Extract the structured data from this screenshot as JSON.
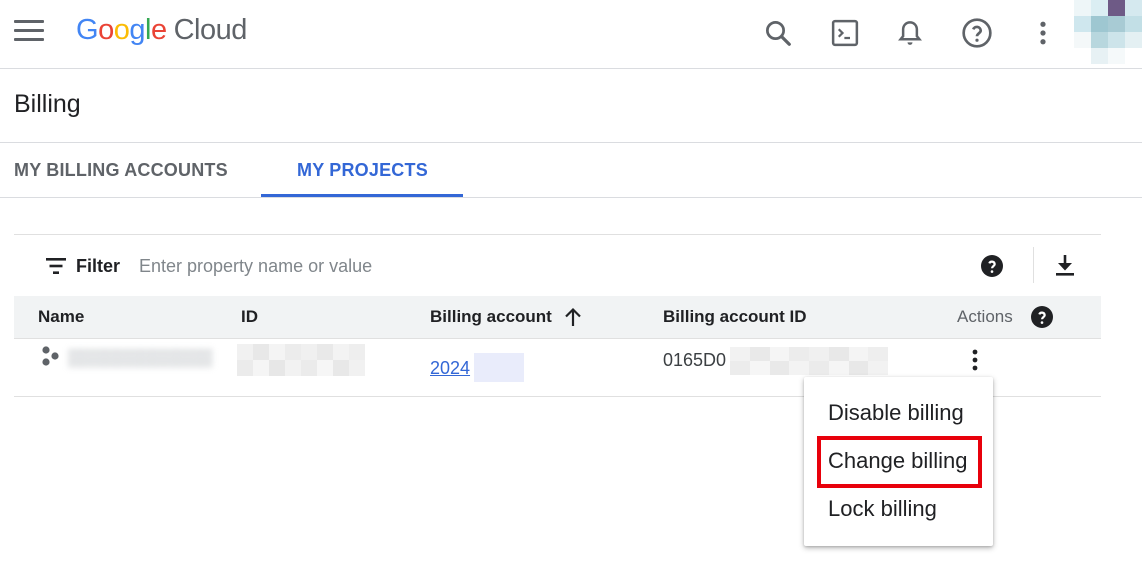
{
  "header": {
    "brand_letters": [
      "G",
      "o",
      "o",
      "g",
      "l",
      "e"
    ],
    "brand_product": "Cloud",
    "icons": [
      "menu-icon",
      "search-icon",
      "cloud-shell-icon",
      "notifications-icon",
      "help-icon",
      "more-vert-icon"
    ]
  },
  "page": {
    "title": "Billing"
  },
  "tabs": [
    {
      "label": "MY BILLING ACCOUNTS",
      "active": false
    },
    {
      "label": "MY PROJECTS",
      "active": true
    }
  ],
  "filter": {
    "label": "Filter",
    "placeholder": "Enter property name or value"
  },
  "table": {
    "columns": [
      "Name",
      "ID",
      "Billing account",
      "Billing account ID",
      "Actions"
    ],
    "sort_column": "Billing account",
    "sort_direction": "ascending",
    "rows": [
      {
        "name": "hidden",
        "billing_account": "2024",
        "billing_account_id": "0165D0"
      }
    ]
  },
  "actions_menu": {
    "items": [
      "Disable billing",
      "Change billing",
      "Lock billing"
    ],
    "highlighted": "Change billing"
  },
  "colors": {
    "accent": "#3367d6",
    "highlight_border": "#e8000b",
    "header_bg": "#f1f3f4"
  }
}
